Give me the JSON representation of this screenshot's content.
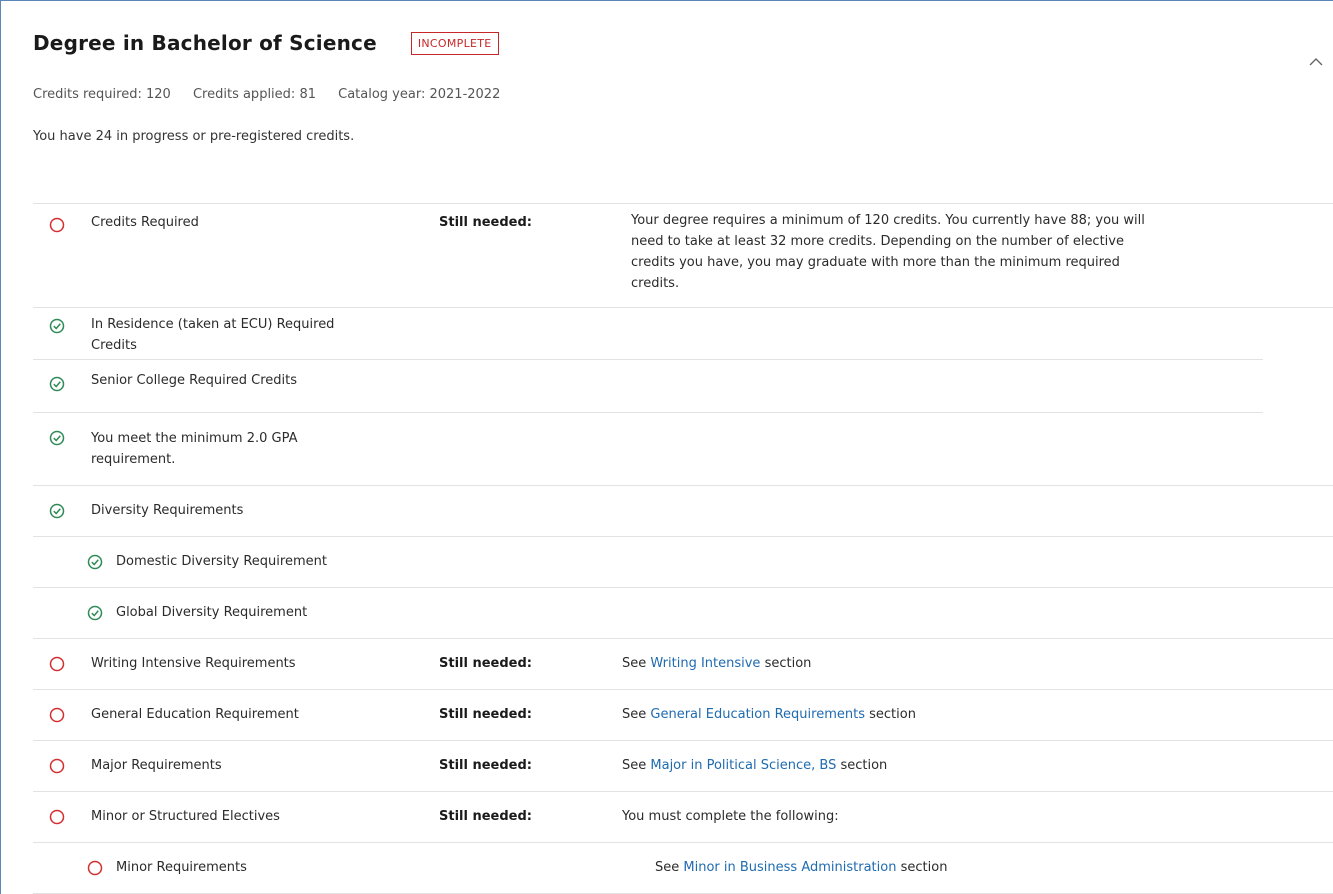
{
  "header": {
    "title": "Degree in Bachelor of Science",
    "status_badge": "INCOMPLETE"
  },
  "meta": {
    "credits_required_label": "Credits required:",
    "credits_required_value": "120",
    "credits_applied_label": "Credits applied:",
    "credits_applied_value": "81",
    "catalog_year_label": "Catalog year:",
    "catalog_year_value": "2021-2022"
  },
  "in_progress_text": "You have 24 in progress or pre-registered credits.",
  "requirements": [
    {
      "name": "Credits Required",
      "status": "incomplete",
      "still_needed": "Still needed:",
      "detail_lines": [
        "Your degree requires a minimum of 120 credits. You currently have 88; you will",
        "need to take at least 32 more credits. Depending on the number of elective",
        "credits you have, you may graduate with more than the minimum required",
        "credits."
      ]
    },
    {
      "name_lines": [
        "In Residence (taken at ECU) Required",
        "Credits"
      ],
      "status": "complete"
    },
    {
      "name": "Senior College Required Credits",
      "status": "complete"
    },
    {
      "name_lines": [
        "You meet the minimum 2.0 GPA",
        "requirement."
      ],
      "status": "complete"
    },
    {
      "name": "Diversity Requirements",
      "status": "complete"
    },
    {
      "name": "Domestic Diversity Requirement",
      "status": "complete"
    },
    {
      "name": "Global Diversity Requirement",
      "status": "complete"
    },
    {
      "name": "Writing Intensive Requirements",
      "status": "incomplete",
      "still_needed": "Still needed:",
      "see_prefix": "See",
      "link_text": "Writing Intensive",
      "see_suffix": "section"
    },
    {
      "name": "General Education Requirement",
      "status": "incomplete",
      "still_needed": "Still needed:",
      "see_prefix": "See",
      "link_text": "General Education Requirements",
      "see_suffix": "section"
    },
    {
      "name": "Major Requirements",
      "status": "incomplete",
      "still_needed": "Still needed:",
      "see_prefix": "See",
      "link_text": "Major in Political Science, BS",
      "see_suffix": "section"
    },
    {
      "name": "Minor or Structured Electives",
      "status": "incomplete",
      "still_needed": "Still needed:",
      "detail": "You must complete the following:"
    },
    {
      "name": "Minor Requirements",
      "status": "incomplete",
      "see_prefix": "See",
      "link_text": "Minor in Business Administration",
      "see_suffix": "section"
    }
  ],
  "colors": {
    "incomplete": "#d32f2f",
    "complete": "#2e8b57",
    "link": "#1f6bb0",
    "frame_border": "#5b86b8"
  },
  "icons": {
    "incomplete": "circle-outline-icon",
    "complete": "check-circle-icon",
    "collapse": "chevron-up-icon"
  }
}
